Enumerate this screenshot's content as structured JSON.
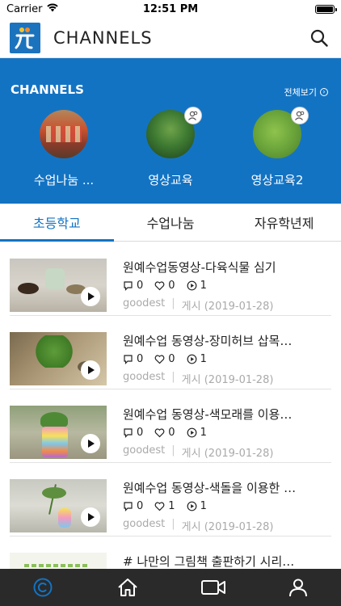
{
  "status": {
    "carrier": "Carrier",
    "time": "12:51 PM"
  },
  "header": {
    "title": "CHANNELS"
  },
  "channels": {
    "title": "CHANNELS",
    "see_all": "전체보기",
    "items": [
      {
        "label": "수업나눔 ..."
      },
      {
        "label": "영상교육"
      },
      {
        "label": "영상교육2"
      }
    ]
  },
  "tabs": [
    {
      "label": "초등학교",
      "active": true
    },
    {
      "label": "수업나눔",
      "active": false
    },
    {
      "label": "자유학년제",
      "active": false
    }
  ],
  "videos": [
    {
      "title": "원예수업동영상-다육식물 심기",
      "comments": "0",
      "likes": "0",
      "views": "1",
      "author": "goodest",
      "date": "게시 (2019-01-28)"
    },
    {
      "title": "원예수업 동영상-장미허브 삽목…",
      "comments": "0",
      "likes": "0",
      "views": "1",
      "author": "goodest",
      "date": "게시 (2019-01-28)"
    },
    {
      "title": "원예수업 동영상-색모래를 이용…",
      "comments": "0",
      "likes": "0",
      "views": "1",
      "author": "goodest",
      "date": "게시 (2019-01-28)"
    },
    {
      "title": "원예수업 동영상-색돌을 이용한 …",
      "comments": "0",
      "likes": "1",
      "views": "1",
      "author": "goodest",
      "date": "게시 (2019-01-28)"
    },
    {
      "title": "# 나만의 그림책 출판하기 시리…"
    }
  ],
  "nav": {
    "items": [
      "channels-icon",
      "home-icon",
      "video-camera-icon",
      "profile-icon"
    ],
    "active_color": "#1373c3",
    "inactive_color": "#ffffff"
  },
  "colors": {
    "primary": "#1373c3"
  }
}
